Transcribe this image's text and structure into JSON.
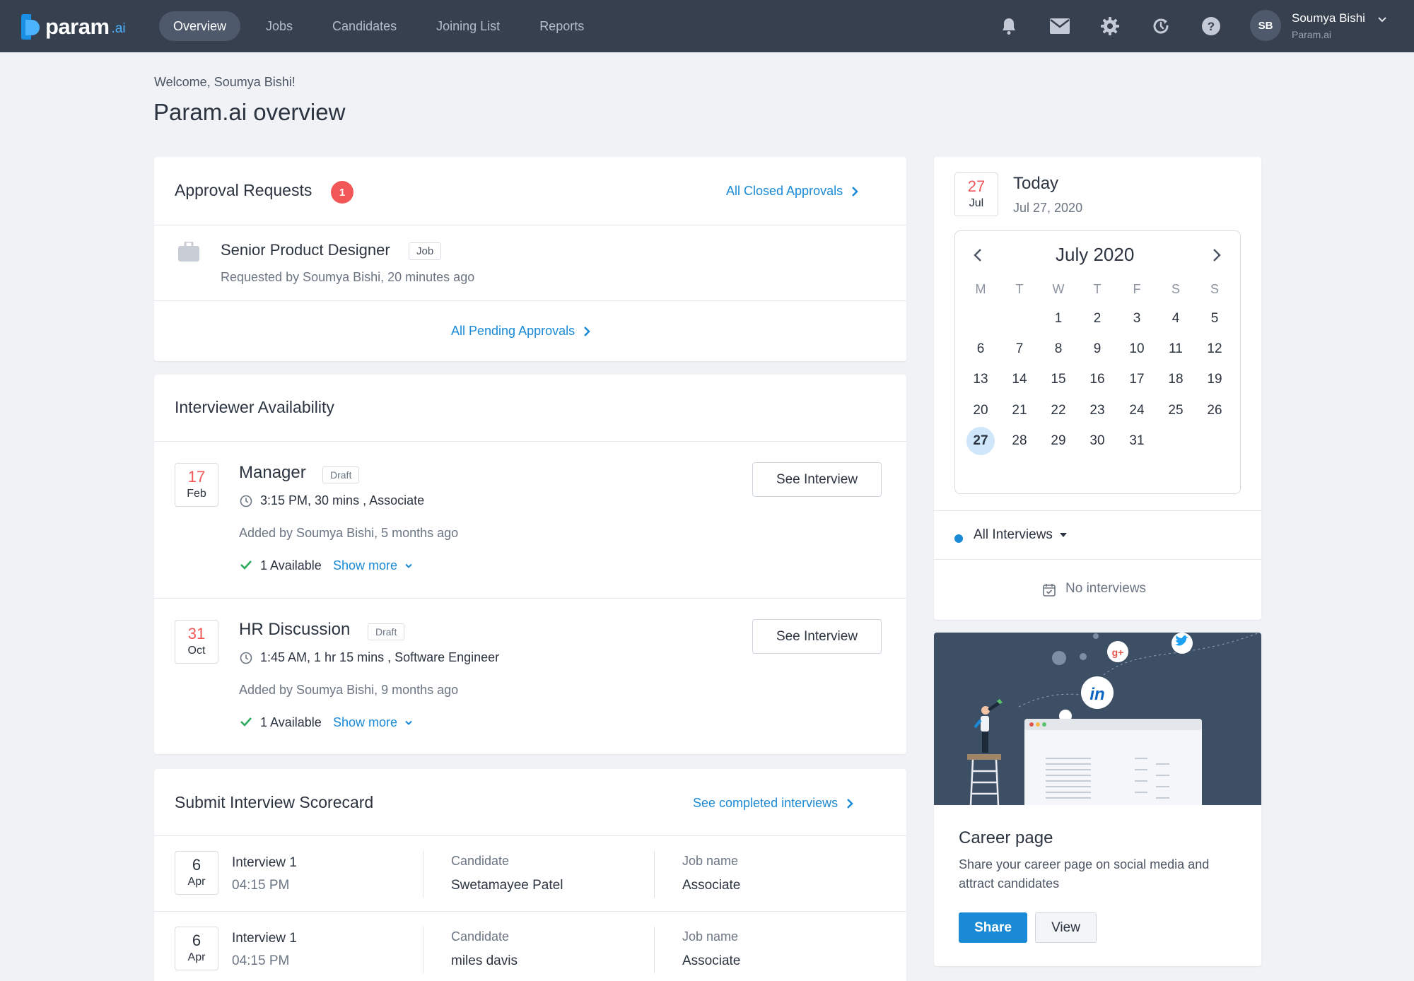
{
  "nav": {
    "logo_text": "param",
    "logo_suffix": ".ai",
    "links": [
      "Overview",
      "Jobs",
      "Candidates",
      "Joining List",
      "Reports"
    ],
    "active": "Overview",
    "icons": [
      "bell-icon",
      "mail-icon",
      "gear-icon",
      "history-icon",
      "help-icon"
    ],
    "user": {
      "initials": "SB",
      "name": "Soumya Bishi",
      "org": "Param.ai"
    }
  },
  "header": {
    "welcome": "Welcome, Soumya Bishi!",
    "title": "Param.ai overview"
  },
  "approvals": {
    "title": "Approval Requests",
    "count": "1",
    "closed_link": "All Closed Approvals",
    "item": {
      "title": "Senior Product Designer",
      "tag": "Job",
      "meta": "Requested by Soumya Bishi, 20 minutes ago"
    },
    "pending_link": "All Pending Approvals"
  },
  "availability": {
    "title": "Interviewer Availability",
    "items": [
      {
        "day": "17",
        "month": "Feb",
        "title": "Manager",
        "tag": "Draft",
        "time": "3:15 PM, 30 mins , Associate",
        "added": "Added by Soumya Bishi, 5 months ago",
        "available": "1 Available",
        "show_more": "Show more",
        "button": "See Interview"
      },
      {
        "day": "31",
        "month": "Oct",
        "title": "HR Discussion",
        "tag": "Draft",
        "time": "1:45 AM, 1 hr 15 mins , Software Engineer",
        "added": "Added by Soumya Bishi, 9 months ago",
        "available": "1 Available",
        "show_more": "Show more",
        "button": "See Interview"
      }
    ]
  },
  "scorecard": {
    "title": "Submit Interview Scorecard",
    "link": "See completed interviews",
    "candidate_label": "Candidate",
    "job_label": "Job name",
    "rows": [
      {
        "day": "6",
        "month": "Apr",
        "name": "Interview 1",
        "time": "04:15 PM",
        "candidate": "Swetamayee Patel",
        "job": "Associate"
      },
      {
        "day": "6",
        "month": "Apr",
        "name": "Interview 1",
        "time": "04:15 PM",
        "candidate": "miles davis",
        "job": "Associate"
      }
    ]
  },
  "today": {
    "day": "27",
    "month": "Jul",
    "label": "Today",
    "date": "Jul 27, 2020",
    "calendar": {
      "title": "July 2020",
      "weekdays": [
        "M",
        "T",
        "W",
        "T",
        "F",
        "S",
        "S"
      ],
      "first_weekday_index": 2,
      "days_in_month": 31,
      "selected": 27,
      "days": [
        "1",
        "2",
        "3",
        "4",
        "5",
        "6",
        "7",
        "8",
        "9",
        "10",
        "11",
        "12",
        "13",
        "14",
        "15",
        "16",
        "17",
        "18",
        "19",
        "20",
        "21",
        "22",
        "23",
        "24",
        "25",
        "26",
        "27",
        "28",
        "29",
        "30",
        "31"
      ]
    },
    "filter": "All Interviews",
    "empty": "No interviews"
  },
  "career": {
    "title": "Career page",
    "desc_line1": "Share your career page on social media and",
    "desc_line2": "attract candidates",
    "share": "Share",
    "view": "View",
    "colors": {
      "illustration_bg": "#3d4f65",
      "primary": "#1a8ad6"
    }
  }
}
